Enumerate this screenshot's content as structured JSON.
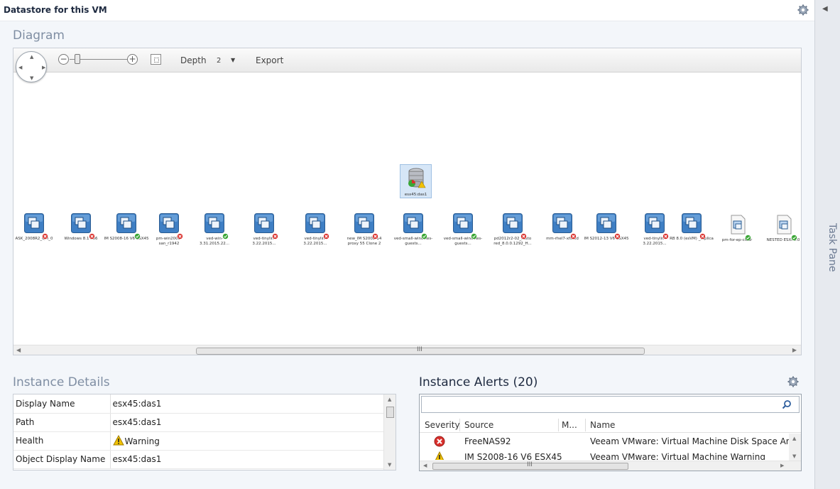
{
  "header": {
    "title": "Datastore for this VM"
  },
  "task_pane": {
    "label": "Task Pane"
  },
  "diagram": {
    "title": "Diagram",
    "toolbar": {
      "depth_label": "Depth",
      "depth_value": "2",
      "export_label": "Export"
    },
    "datastore": {
      "name": "esx45:das1",
      "health": "warning"
    },
    "nodes": [
      {
        "name": "ASK_2008R2_QM_0",
        "status": "error",
        "type": "vm"
      },
      {
        "name": "Windows 8.1 x86",
        "status": "error",
        "type": "vm"
      },
      {
        "name": "IM S2008-16 V6 ESX45",
        "status": "ok",
        "type": "vm"
      },
      {
        "name": "pm-win2003-san_r1942",
        "status": "error",
        "type": "vm"
      },
      {
        "name": "ved-win-3.31.2015.22...",
        "status": "ok",
        "type": "vm"
      },
      {
        "name": "ved-tinylin-3.22.2015...",
        "status": "error",
        "type": "vm"
      },
      {
        "name": "ved-tinylin-3.22.2015...",
        "status": "error",
        "type": "vm"
      },
      {
        "name": "new_IM S2008-14 proxy 55 Clone 2",
        "status": "error",
        "type": "vm"
      },
      {
        "name": "ved-small-windows-guests...",
        "status": "ok",
        "type": "vm"
      },
      {
        "name": "ved-small-windows-guests...",
        "status": "ok",
        "type": "vm"
      },
      {
        "name": "pd2012r2-02_resto red_8.0.0.1292_H...",
        "status": "error",
        "type": "vm"
      },
      {
        "name": "mm-rhel7-xfsted",
        "status": "error",
        "type": "vm"
      },
      {
        "name": "IM S2012-13 V6 ESX45",
        "status": "error",
        "type": "vm"
      },
      {
        "name": "ved-tinylin-3.22.2015...",
        "status": "error",
        "type": "vm"
      },
      {
        "name": "RB 8.0 (esVM) _replica",
        "status": "error",
        "type": "vm"
      },
      {
        "name": "pm-for-ep-clear",
        "status": "ok",
        "type": "template"
      },
      {
        "name": "NESTED ESXi 6.0",
        "status": "ok",
        "type": "template"
      }
    ]
  },
  "details": {
    "title": "Instance Details",
    "rows": [
      {
        "key": "Display Name",
        "value": "esx45:das1"
      },
      {
        "key": "Path",
        "value": "esx45:das1"
      },
      {
        "key": "Health",
        "value": "Warning"
      },
      {
        "key": "Object Display Name",
        "value": "esx45:das1"
      }
    ]
  },
  "alerts": {
    "title": "Instance Alerts (20)",
    "search_value": "",
    "columns": {
      "severity": "Severity",
      "source": "Source",
      "m": "M...",
      "name": "Name"
    },
    "rows": [
      {
        "severity": "error",
        "source": "FreeNAS92",
        "name": "Veeam VMware: Virtual Machine Disk Space Analysis"
      },
      {
        "severity": "warning",
        "source": "IM S2008-16 V6 ESX45",
        "name": "Veeam VMware: Virtual Machine Warning"
      }
    ]
  },
  "colors": {
    "accent": "#1e2a40",
    "section_title": "#7f8ea3",
    "error": "#d9302c",
    "ok": "#3aa635",
    "warning": "#f2c200"
  }
}
